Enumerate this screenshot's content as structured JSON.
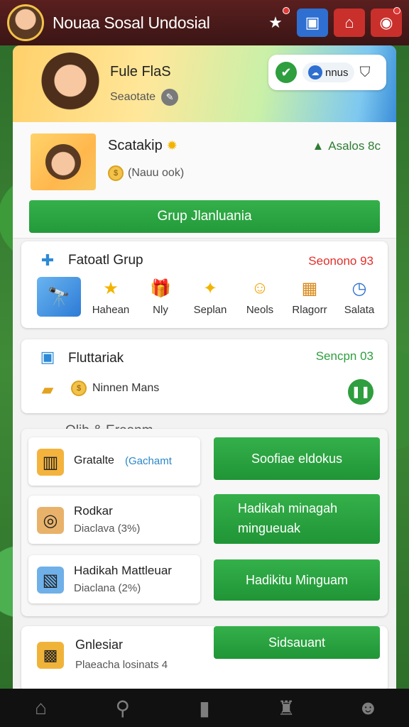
{
  "header": {
    "title": "Nouaa Sosal Undosial",
    "icons": [
      "star-icon",
      "chat-icon",
      "home-icon",
      "notification-icon"
    ]
  },
  "hero": {
    "name": "Fule FlaS",
    "subtitle": "Seaotate",
    "pill_text": "nnus"
  },
  "profile": {
    "name": "Scatakip",
    "sub": "Nauu ook",
    "right": "Asalos 8c",
    "button": "Grup Jlanluania"
  },
  "friends_card": {
    "title": "Fatoatl Grup",
    "right": "Seonono 93",
    "items": [
      {
        "label": "Hahean",
        "icon": "star"
      },
      {
        "label": "Nly",
        "icon": "gift"
      },
      {
        "label": "Seplan",
        "icon": "stars"
      },
      {
        "label": "Neols",
        "icon": "smiley"
      },
      {
        "label": "Rlagorr",
        "icon": "map"
      },
      {
        "label": "Salata",
        "icon": "clock"
      }
    ]
  },
  "task_card": {
    "title": "Fluttariak",
    "right": "Sencpn 03",
    "sub": "Ninnen Mans"
  },
  "section": {
    "heading": "Olib & Eroanm",
    "tiles": [
      {
        "title": "Gratalte",
        "subtitle": "Gachamt",
        "button": "Soofiae eldokus"
      },
      {
        "title": "Rodkar",
        "subtitle": "Diaclava (3%)",
        "button_line1": "Hadikah minagah",
        "button_line2": "mingueuak"
      },
      {
        "title": "Hadikah Mattleuar",
        "subtitle": "Diaclana (2%)",
        "button": "Hadikitu Minguam"
      },
      {
        "title": "Gnlesiar",
        "subtitle": "Plaeacha losinats 4",
        "button": "Sidsauant"
      }
    ]
  },
  "nav": [
    "home",
    "search",
    "shop",
    "trophy",
    "profile"
  ]
}
